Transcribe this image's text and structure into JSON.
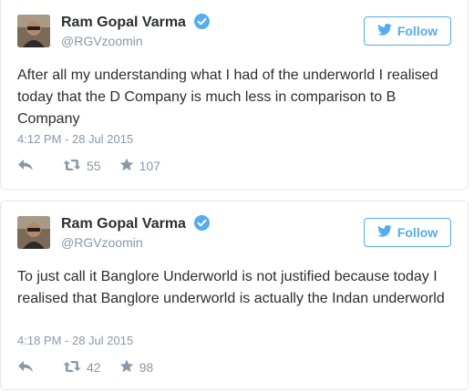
{
  "tweets": [
    {
      "author_name": "Ram Gopal Varma",
      "handle": "@RGVzoomin",
      "follow_label": "Follow",
      "text": "After all my understanding what I had of the underworld I realised today that the D Company is much less in comparison to B Company",
      "timestamp": "4:12 PM - 28 Jul 2015",
      "retweets": "55",
      "favorites": "107"
    },
    {
      "author_name": "Ram Gopal Varma",
      "handle": "@RGVzoomin",
      "follow_label": "Follow",
      "text": "To just call it Banglore Underworld is not justified because today I realised that Banglore underworld is actually the Indan underworld",
      "timestamp": "4:18 PM - 28 Jul 2015",
      "retweets": "42",
      "favorites": "98"
    }
  ],
  "colors": {
    "accent": "#55acee",
    "verified": "#55acee",
    "muted": "#8899a6",
    "text": "#292f33",
    "border": "#e1e8ed"
  },
  "icons": [
    "twitter-bird-icon",
    "verified-badge-icon",
    "reply-icon",
    "retweet-icon",
    "favorite-star-icon"
  ]
}
